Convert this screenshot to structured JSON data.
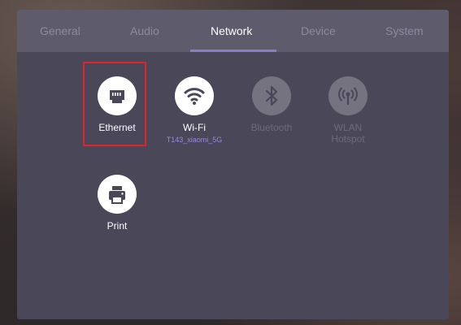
{
  "tabs": [
    {
      "label": "General",
      "active": false
    },
    {
      "label": "Audio",
      "active": false
    },
    {
      "label": "Network",
      "active": true
    },
    {
      "label": "Device",
      "active": false
    },
    {
      "label": "System",
      "active": false
    }
  ],
  "items": {
    "ethernet": {
      "label": "Ethernet",
      "icon": "ethernet-icon",
      "selected": true
    },
    "wifi": {
      "label": "Wi-Fi",
      "sublabel": "T143_xiaomi_5G",
      "icon": "wifi-icon"
    },
    "bluetooth": {
      "label": "Bluetooth",
      "icon": "bluetooth-icon",
      "enabled": false
    },
    "wlan_hotspot": {
      "label_line1": "WLAN",
      "label_line2": "Hotspot",
      "icon": "hotspot-icon",
      "enabled": false
    },
    "print": {
      "label": "Print",
      "icon": "printer-icon"
    }
  },
  "colors": {
    "accent": "#8b7dc9",
    "selection": "#e0242a",
    "panel": "#4a4758",
    "tabbar": "#5d5b6c",
    "sublabel": "#9b87e0"
  }
}
